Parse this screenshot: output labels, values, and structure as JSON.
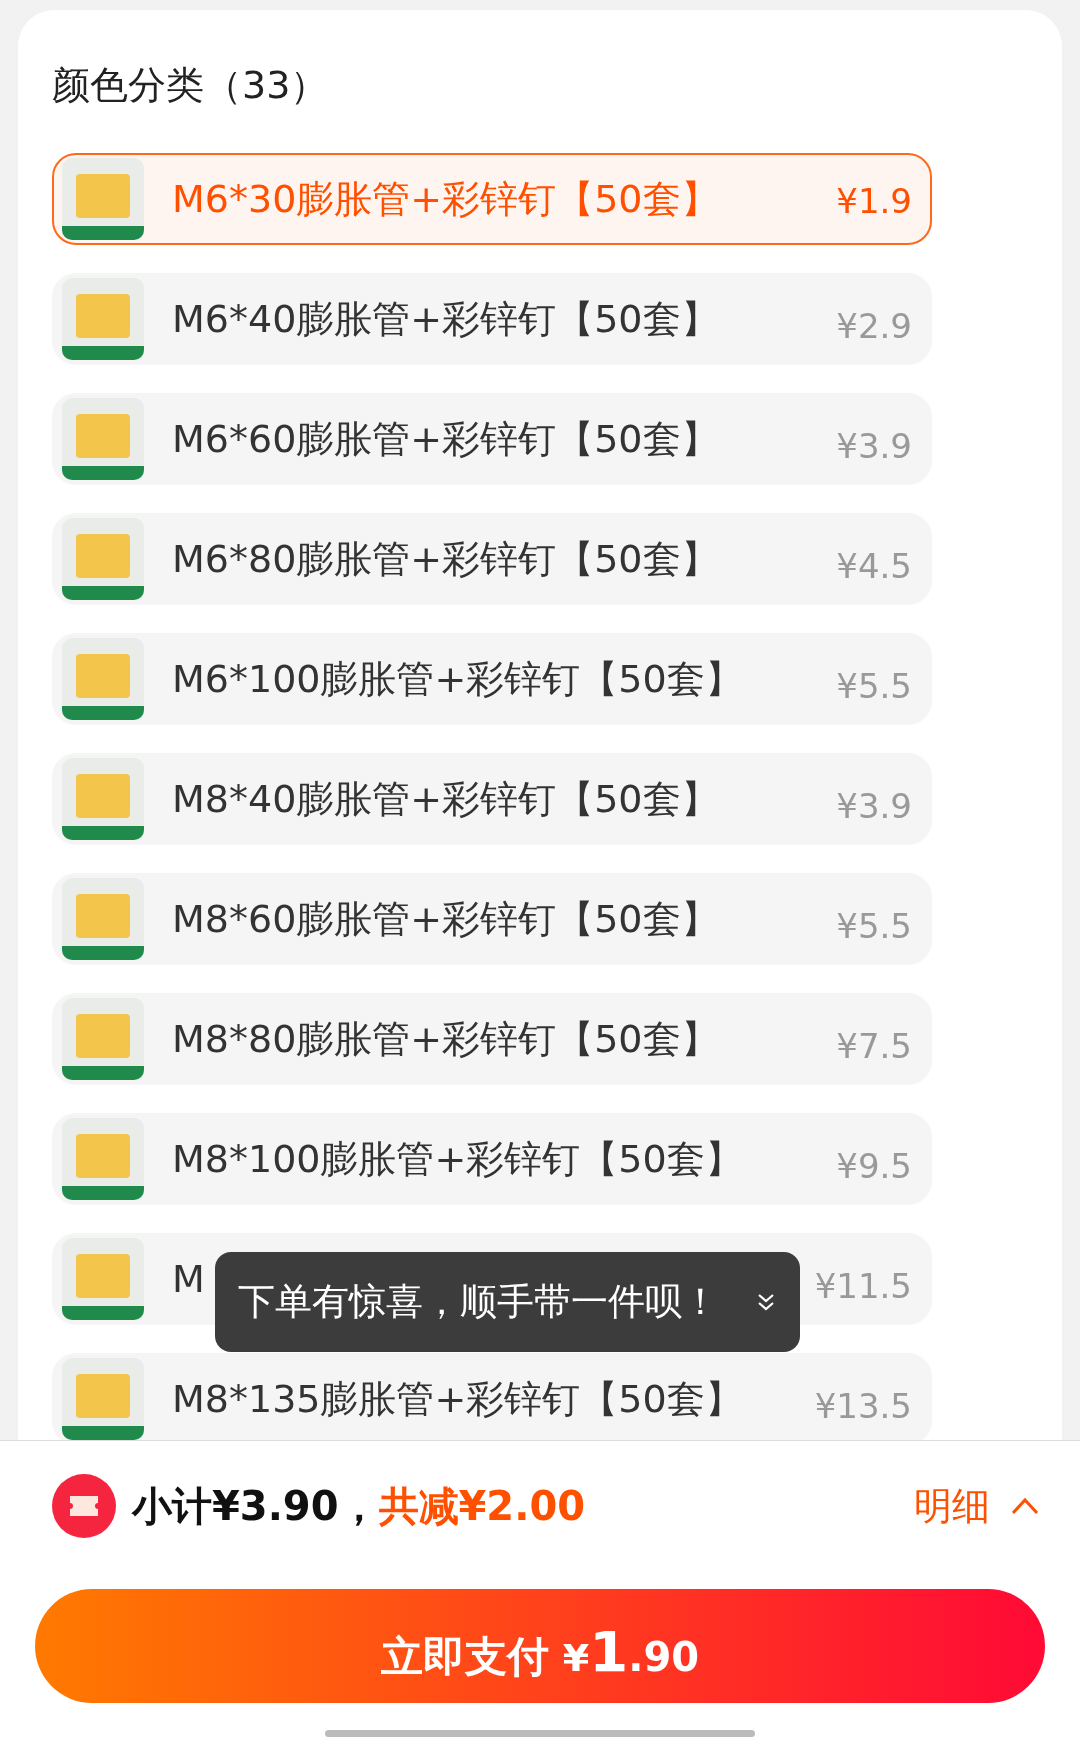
{
  "title": "颜色分类（33）",
  "options": [
    {
      "label": "M6*30膨胀管+彩锌钉【50套】",
      "price": "¥1.9",
      "selected": true
    },
    {
      "label": "M6*40膨胀管+彩锌钉【50套】",
      "price": "¥2.9",
      "selected": false
    },
    {
      "label": "M6*60膨胀管+彩锌钉【50套】",
      "price": "¥3.9",
      "selected": false
    },
    {
      "label": "M6*80膨胀管+彩锌钉【50套】",
      "price": "¥4.5",
      "selected": false
    },
    {
      "label": "M6*100膨胀管+彩锌钉【50套】",
      "price": "¥5.5",
      "selected": false
    },
    {
      "label": "M8*40膨胀管+彩锌钉【50套】",
      "price": "¥3.9",
      "selected": false
    },
    {
      "label": "M8*60膨胀管+彩锌钉【50套】",
      "price": "¥5.5",
      "selected": false
    },
    {
      "label": "M8*80膨胀管+彩锌钉【50套】",
      "price": "¥7.5",
      "selected": false
    },
    {
      "label": "M8*100膨胀管+彩锌钉【50套】",
      "price": "¥9.5",
      "selected": false
    },
    {
      "label": "M",
      "price": "¥11.5",
      "selected": false
    },
    {
      "label": "M8*135膨胀管+彩锌钉【50套】",
      "price": "¥13.5",
      "selected": false
    }
  ],
  "toast": "下单有惊喜，顺手带一件呗！",
  "summary": {
    "subtotal": "小计¥3.90，",
    "discount": "共减¥2.00",
    "details": "明细"
  },
  "pay_button": {
    "label": "立即支付",
    "currency": "¥",
    "amount_int": "1",
    "amount_dec": ".90"
  }
}
